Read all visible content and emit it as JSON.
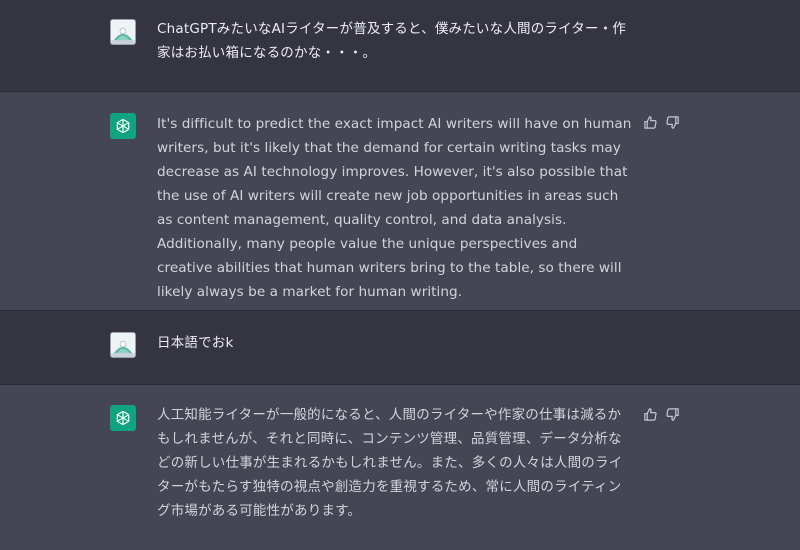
{
  "conversation": {
    "messages": [
      {
        "role": "user",
        "text": "ChatGPTみたいなAIライターが普及すると、僕みたいな人間のライター・作家はお払い箱になるのかな・・・。"
      },
      {
        "role": "assistant",
        "text": "It's difficult to predict the exact impact AI writers will have on human writers, but it's likely that the demand for certain writing tasks may decrease as AI technology improves. However, it's also possible that the use of AI writers will create new job opportunities in areas such as content management, quality control, and data analysis. Additionally, many people value the unique perspectives and creative abilities that human writers bring to the table, so there will likely always be a market for human writing."
      },
      {
        "role": "user",
        "text": "日本語でおk"
      },
      {
        "role": "assistant",
        "text": "人工知能ライターが一般的になると、人間のライターや作家の仕事は減るかもしれませんが、それと同時に、コンテンツ管理、品質管理、データ分析などの新しい仕事が生まれるかもしれません。また、多くの人々は人間のライターがもたらす独特の視点や創造力を重視するため、常に人間のライティング市場がある可能性があります。"
      }
    ]
  },
  "icons": {
    "user_avatar": "user-avatar-image",
    "assistant_avatar": "openai-logo-icon",
    "thumbs_up": "thumbs-up-icon",
    "thumbs_down": "thumbs-down-icon"
  },
  "colors": {
    "user_row_bg": "#343541",
    "assistant_row_bg": "#444654",
    "assistant_avatar_bg": "#10a37f",
    "text": "#ececf1"
  }
}
